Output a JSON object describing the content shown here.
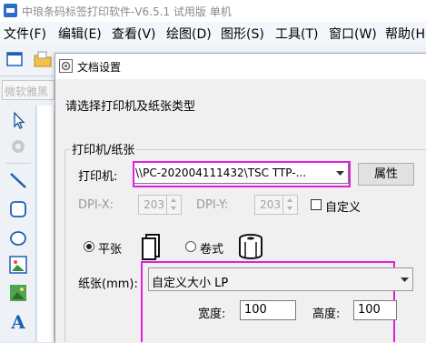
{
  "app": {
    "title": "中琅条码标签打印软件-V6.5.1 试用版 单机",
    "menu": [
      "文件(F)",
      "编辑(E)",
      "查看(V)",
      "绘图(D)",
      "图形(S)",
      "工具(T)",
      "窗口(W)",
      "帮助(H)"
    ],
    "font_placeholder": "微软雅黑"
  },
  "toolbox": {
    "tools": [
      "select-arrow-icon",
      "rotate-icon",
      "line-icon",
      "rounded-rect-icon",
      "ellipse-icon",
      "image-icon",
      "photo-icon",
      "text-a-icon"
    ],
    "text_tool_glyph": "A"
  },
  "dialog": {
    "title": "文档设置",
    "prompt": "请选择打印机及纸张类型",
    "group_title": "打印机/纸张",
    "printer_label": "打印机:",
    "printer_value": "\\\\PC-202004111432\\TSC TTP-...",
    "properties_label": "属性",
    "dpi_x_label": "DPI-X:",
    "dpi_x_value": "203",
    "dpi_y_label": "DPI-Y:",
    "dpi_y_value": "203",
    "custom_label": "自定义",
    "custom_checked": false,
    "paper_mode_flat": "平张",
    "paper_mode_roll": "卷式",
    "paper_mode_selected": "平张",
    "paper_label": "纸张(mm):",
    "paper_value": "自定义大小 LP",
    "width_label": "宽度:",
    "width_value": "100",
    "height_label": "高度:",
    "height_value": "100"
  },
  "colors": {
    "highlight": "#e020e0",
    "accent": "#2e6dc7",
    "dialog_bg": "#f0f0f0"
  }
}
